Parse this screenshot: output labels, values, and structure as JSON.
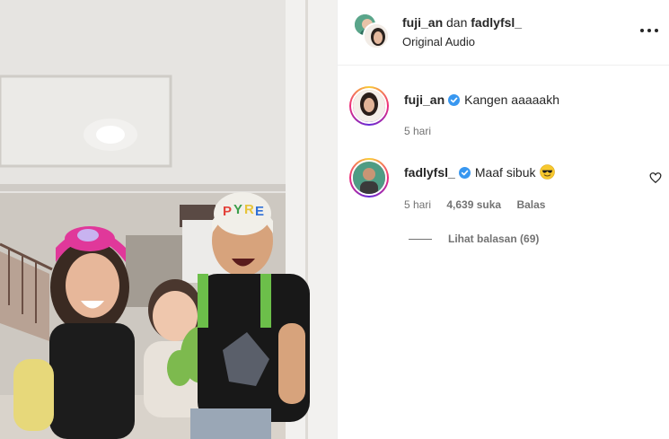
{
  "header": {
    "user1": "fuji_an",
    "joiner": "dan",
    "user2": "fadlyfsl_",
    "subtitle": "Original Audio",
    "more_icon": "more-horizontal-icon"
  },
  "comments": [
    {
      "username": "fuji_an",
      "text": "Kangen aaaaakh",
      "time": "5 hari",
      "avatar_icon": "avatar-fuji-an"
    },
    {
      "username": "fadlyfsl_",
      "text": "Maaf sibuk",
      "emoji_icon": "sunglasses-emoji-icon",
      "time": "5 hari",
      "likes": "4,639 suka",
      "reply_label": "Balas",
      "view_replies": "Lihat balasan (69)",
      "avatar_icon": "avatar-fadlyfsl"
    }
  ],
  "colors": {
    "verified": "#3897f0",
    "text_primary": "#262626",
    "text_secondary": "#737373",
    "divider": "#efefef"
  }
}
